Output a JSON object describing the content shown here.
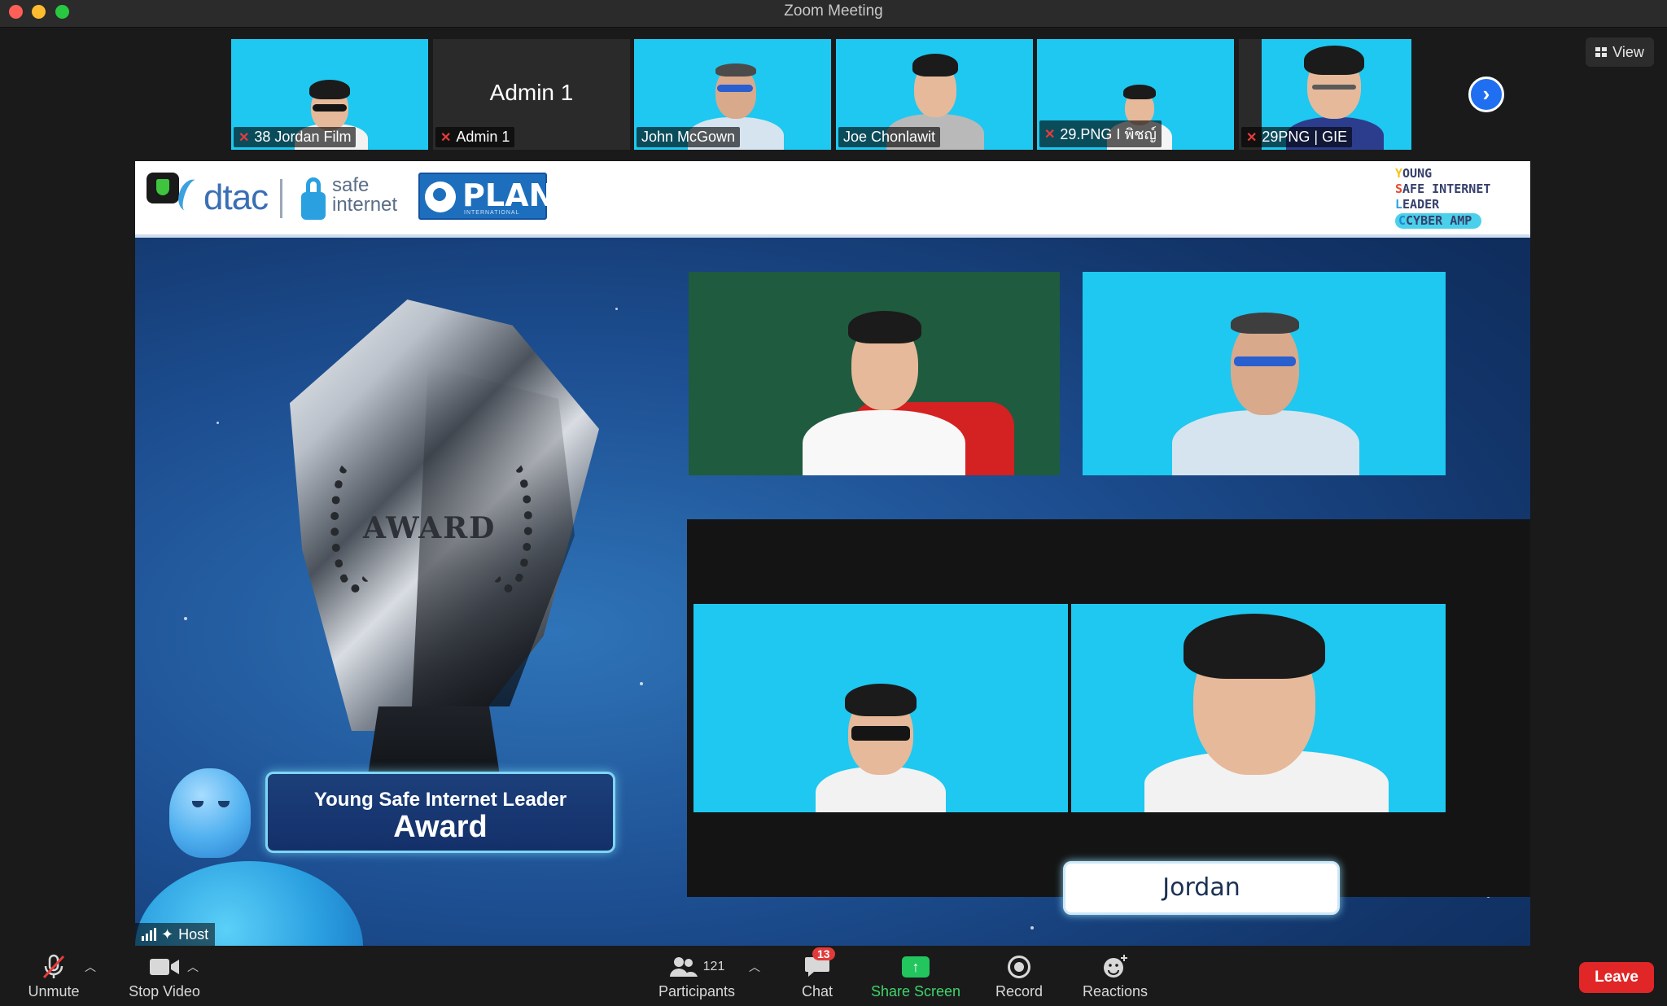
{
  "window": {
    "title": "Zoom Meeting"
  },
  "participants_strip": [
    {
      "name": "38 Jordan Film",
      "muted": true,
      "video": true
    },
    {
      "name": "Admin 1",
      "muted": true,
      "video": false,
      "center_name": "Admin 1"
    },
    {
      "name": "John McGown",
      "muted": false,
      "video": true
    },
    {
      "name": "Joe Chonlawit",
      "muted": false,
      "video": true
    },
    {
      "name": "29.PNG I พิชญ์",
      "muted": true,
      "video": true
    },
    {
      "name": "29PNG | GIE",
      "muted": true,
      "video": true
    }
  ],
  "view_button": {
    "label": "View",
    "icon": "grid-icon"
  },
  "next_page_icon": "chevron-right-icon",
  "shared_screen": {
    "logos": {
      "dtac": "dtac",
      "safe_internet_line1": "safe",
      "safe_internet_line2": "internet",
      "plan": "PLAN",
      "plan_sub": "INTERNATIONAL",
      "ysil_lines": [
        "OUNG",
        "AFE INTERNET",
        "EADER",
        "CYBER AMP"
      ],
      "ysil_initials": [
        "Y",
        "S",
        "L",
        "C"
      ]
    },
    "trophy_text": "AWARD",
    "banner_line1": "Young Safe Internet Leader",
    "banner_line2": "Award",
    "name_card": "Jordan"
  },
  "host_tag": {
    "label": "Host"
  },
  "toolbar": {
    "unmute": "Unmute",
    "stop_video": "Stop Video",
    "participants": "Participants",
    "participants_count": "121",
    "chat": "Chat",
    "chat_badge": "13",
    "share_screen": "Share Screen",
    "record": "Record",
    "reactions": "Reactions",
    "leave": "Leave"
  },
  "colors": {
    "thumb_bg": "#1ec8f0",
    "share_green": "#22c55e",
    "leave_red": "#e02626",
    "accent_blue": "#1f6ff0"
  }
}
